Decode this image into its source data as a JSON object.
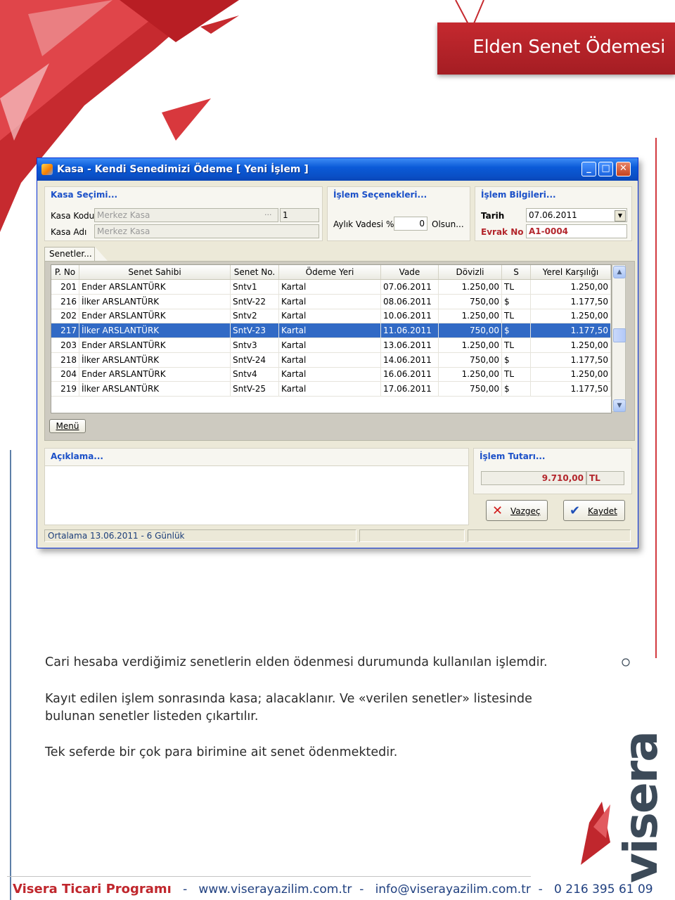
{
  "page": {
    "title": "Elden Senet Ödemesi",
    "description": [
      "Cari hesaba verdiğimiz senetlerin elden ödenmesi durumunda kullanılan işlemdir.",
      "Kayıt edilen işlem sonrasında kasa; alacaklanır. Ve «verilen senetler» listesinde",
      "bulunan senetler listeden çıkartılır.",
      "Tek seferde bir çok para birimine ait senet ödenmektedir."
    ],
    "footer": {
      "brand": "Visera Ticari Programı",
      "separator": "-",
      "website": "www.viserayazilim.com.tr",
      "email": "info@viserayazilim.com.tr",
      "phone": "0 216 395 61 09"
    },
    "logo_text": "visera",
    "colors": {
      "brand_red": "#c0272d",
      "brand_gray": "#3c4a58",
      "accent_blue": "#1b50c8"
    }
  },
  "window": {
    "title": "Kasa - Kendi Senedimizi Ödeme   [ Yeni İşlem ]",
    "controls": {
      "minimize": "_",
      "maximize": "□",
      "close": "✕"
    },
    "kasa_group": {
      "title": "Kasa Seçimi...",
      "kod_label": "Kasa Kodu",
      "kod_value": "Merkez Kasa",
      "kod_lookup": "...",
      "kod_no": "1",
      "adi_label": "Kasa Adı",
      "adi_value": "Merkez Kasa"
    },
    "options_group": {
      "title": "İşlem Seçenekleri...",
      "vade_label": "Aylık Vadesi %",
      "vade_value": "0",
      "olsun_label": "Olsun..."
    },
    "info_group": {
      "title": "İşlem Bilgileri...",
      "tarih_label": "Tarih",
      "tarih_value": "07.06.2011",
      "evrak_label": "Evrak No",
      "evrak_value": "A1-0004"
    },
    "tab_label": "Senetler...",
    "table": {
      "columns": [
        "P. No",
        "Senet Sahibi",
        "Senet No.",
        "Ödeme Yeri",
        "Vade",
        "Dövizli",
        "S",
        "Yerel Karşılığı"
      ],
      "rows": [
        [
          "201",
          "Ender ARSLANTÜRK",
          "Sntv1",
          "Kartal",
          "07.06.2011",
          "1.250,00",
          "TL",
          "1.250,00"
        ],
        [
          "216",
          "İlker ARSLANTÜRK",
          "SntV-22",
          "Kartal",
          "08.06.2011",
          "750,00",
          "$",
          "1.177,50"
        ],
        [
          "202",
          "Ender ARSLANTÜRK",
          "Sntv2",
          "Kartal",
          "10.06.2011",
          "1.250,00",
          "TL",
          "1.250,00"
        ],
        [
          "217",
          "İlker ARSLANTÜRK",
          "SntV-23",
          "Kartal",
          "11.06.2011",
          "750,00",
          "$",
          "1.177,50"
        ],
        [
          "203",
          "Ender ARSLANTÜRK",
          "Sntv3",
          "Kartal",
          "13.06.2011",
          "1.250,00",
          "TL",
          "1.250,00"
        ],
        [
          "218",
          "İlker ARSLANTÜRK",
          "SntV-24",
          "Kartal",
          "14.06.2011",
          "750,00",
          "$",
          "1.177,50"
        ],
        [
          "204",
          "Ender ARSLANTÜRK",
          "Sntv4",
          "Kartal",
          "16.06.2011",
          "1.250,00",
          "TL",
          "1.250,00"
        ],
        [
          "219",
          "İlker ARSLANTÜRK",
          "SntV-25",
          "Kartal",
          "17.06.2011",
          "750,00",
          "$",
          "1.177,50"
        ]
      ],
      "selected_row": 3
    },
    "menu_button": "Menü",
    "aciklama_title": "Açıklama...",
    "tutar_group": {
      "title": "İşlem Tutarı...",
      "amount": "9.710,00",
      "currency": "TL"
    },
    "cancel_button": "Vazgeç",
    "save_button": "Kaydet",
    "status_text": "Ortalama 13.06.2011 - 6 Günlük"
  }
}
